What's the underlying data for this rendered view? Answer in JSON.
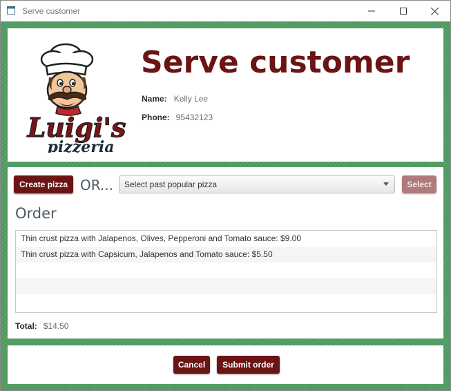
{
  "window": {
    "title": "Serve customer",
    "minimize_glyph": "—",
    "maximize_glyph": "☐",
    "close_glyph": "✕"
  },
  "header": {
    "heading": "Serve customer",
    "logo_name": "Luigi's",
    "logo_sub": "pizzeria",
    "name_label": "Name:",
    "name_value": "Kelly Lee",
    "phone_label": "Phone:",
    "phone_value": "95432123"
  },
  "toolbar": {
    "create_label": "Create pizza",
    "or_text": "OR...",
    "select_placeholder": "Select past popular pizza",
    "select_button_label": "Select"
  },
  "order": {
    "heading": "Order",
    "items": [
      "Thin crust pizza with Jalapenos, Olives, Pepperoni and Tomato sauce: $9.00",
      "Thin crust pizza with Capsicum, Jalapenos and Tomato sauce: $5.50"
    ],
    "total_label": "Total:",
    "total_value": "$14.50"
  },
  "footer": {
    "cancel_label": "Cancel",
    "submit_label": "Submit order"
  },
  "colors": {
    "brand": "#6b1414",
    "background_green": "#4e9e60",
    "disabled_button": "#b07a7a"
  }
}
